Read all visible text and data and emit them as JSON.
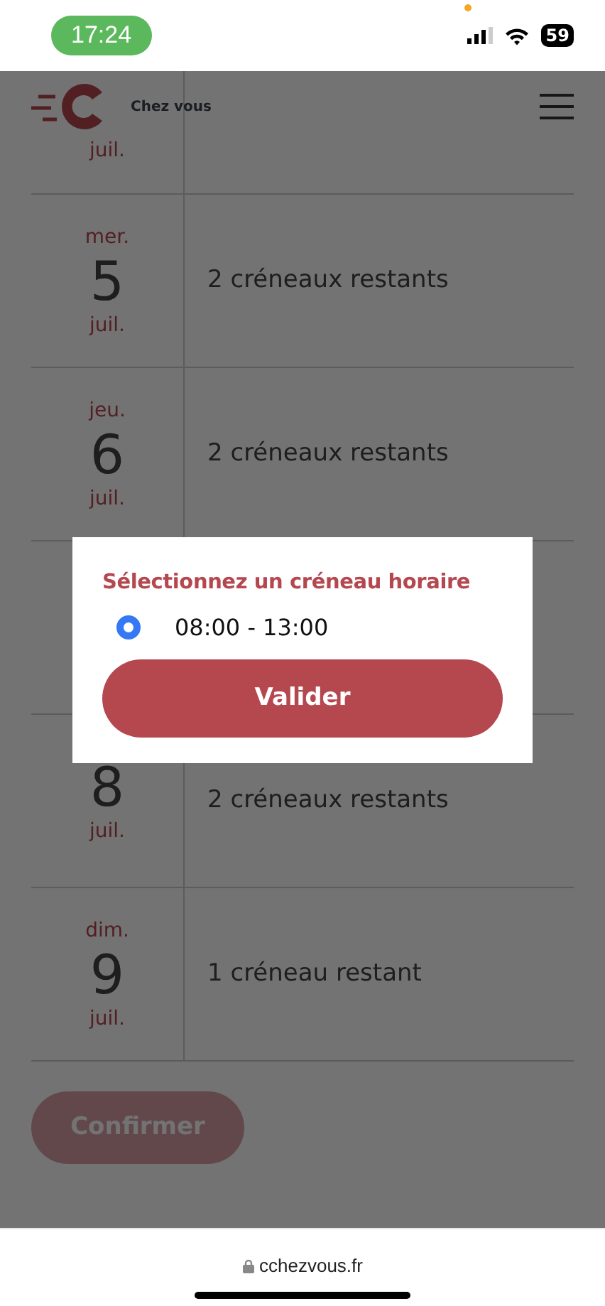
{
  "status_bar": {
    "time": "17:24",
    "battery": "59"
  },
  "header": {
    "brand": "Chez vous"
  },
  "days_above_dialog": [
    {
      "month": "juil."
    },
    {
      "day_name": "mer.",
      "number": "5",
      "month": "juil.",
      "slots": "2 créneaux restants"
    },
    {
      "day_name": "jeu.",
      "number": "6",
      "month": "juil.",
      "slots": "2 créneaux restants"
    }
  ],
  "days_below_dialog": [
    {
      "number": "8",
      "month": "juil.",
      "slots": "2 créneaux restants"
    },
    {
      "day_name": "dim.",
      "number": "9",
      "month": "juil.",
      "slots": "1 créneau restant"
    }
  ],
  "confirm_button": "Confirmer",
  "modal": {
    "title": "Sélectionnez un créneau horaire",
    "options": [
      {
        "label": "08:00 - 13:00",
        "selected": true
      }
    ],
    "button": "Valider"
  },
  "browser": {
    "url": "cchezvous.fr"
  }
}
